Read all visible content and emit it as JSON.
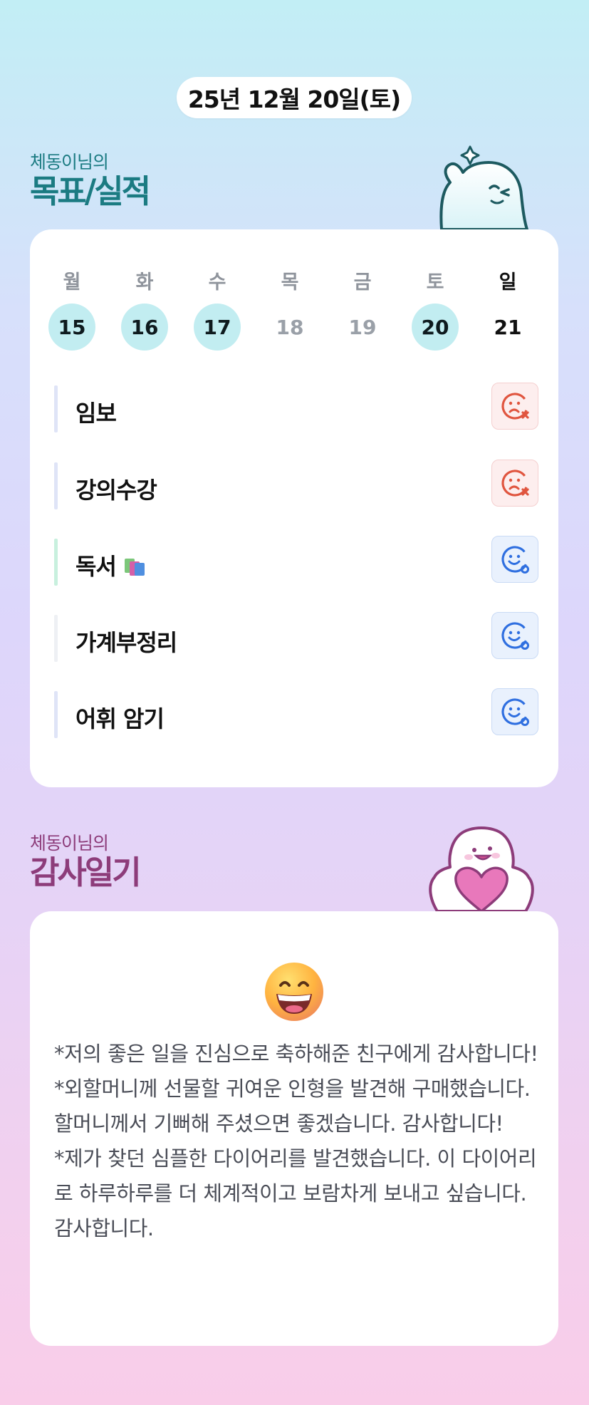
{
  "header": {
    "date": "25년 12월 20일(토)"
  },
  "goal_section": {
    "owner": "체동이님의",
    "title": "목표/실적"
  },
  "week": {
    "days": [
      {
        "label": "월",
        "num": "15",
        "done": true
      },
      {
        "label": "화",
        "num": "16",
        "done": true
      },
      {
        "label": "수",
        "num": "17",
        "done": true
      },
      {
        "label": "목",
        "num": "18",
        "done": false
      },
      {
        "label": "금",
        "num": "19",
        "done": false
      },
      {
        "label": "토",
        "num": "20",
        "done": true
      },
      {
        "label": "일",
        "num": "21",
        "done": false,
        "sunday": true
      }
    ]
  },
  "goals": [
    {
      "name": "임보",
      "status": "sad-icon",
      "bar_color": "#dfe4f7"
    },
    {
      "name": "강의수강",
      "status": "sad-icon",
      "bar_color": "#dfe4f7"
    },
    {
      "name": "독서",
      "status": "happy-icon",
      "bar_color": "#c8f0de",
      "icon": "books-icon"
    },
    {
      "name": "가계부정리",
      "status": "happy-icon",
      "bar_color": "#eef0f4"
    },
    {
      "name": "어휘 암기",
      "status": "happy-icon",
      "bar_color": "#dfe4f7"
    }
  ],
  "thanks_section": {
    "owner": "체동이님의",
    "title": "감사일기"
  },
  "thanks": {
    "emoji": "grinning-face-icon",
    "lines": [
      "*저의 좋은 일을 진심으로 축하해준 친구에게 감사합니다!",
      "*외할머니께 선물할 귀여운 인형을 발견해 구매했습니다. 할머니께서 기뻐해 주셨으면 좋겠습니다. 감사합니다!",
      "*제가 찾던 심플한 다이어리를 발견했습니다. 이 다이어리로 하루하루를 더 체계적이고 보람차게 보내고 싶습니다. 감사합니다."
    ]
  },
  "colors": {
    "goal_accent": "#1b7b82",
    "thanks_accent": "#8d3c7a",
    "done_day": "#c2edf1",
    "sad": "#e0553f",
    "happy": "#2f6fe0"
  }
}
